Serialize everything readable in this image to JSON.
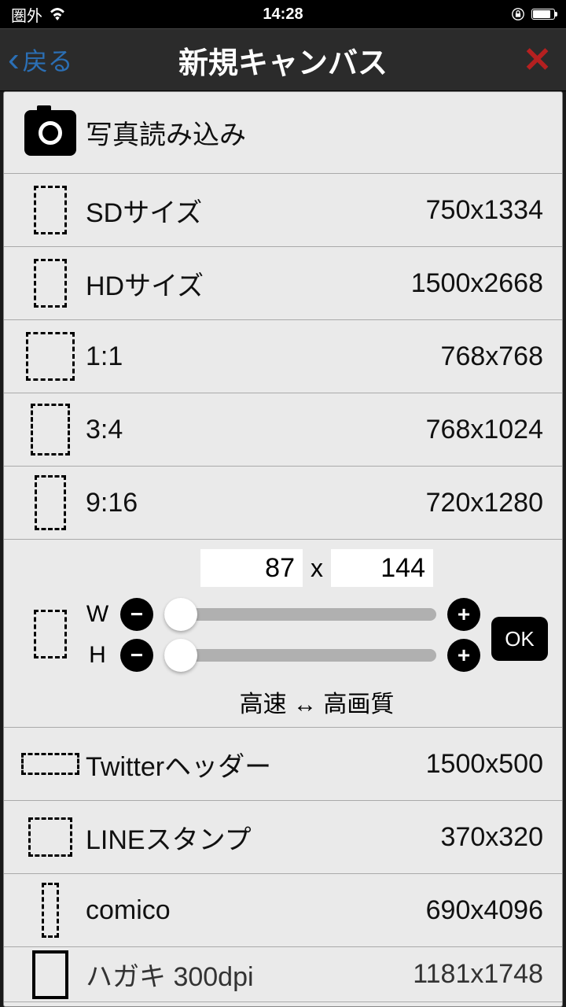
{
  "status": {
    "carrier": "圏外",
    "time": "14:28"
  },
  "nav": {
    "back": "戻る",
    "title": "新規キャンバス"
  },
  "photo_import": "写真読み込み",
  "presets": [
    {
      "label": "SDサイズ",
      "size": "750x1334",
      "shape": "dash-port"
    },
    {
      "label": "HDサイズ",
      "size": "1500x2668",
      "shape": "dash-port"
    },
    {
      "label": "1:1",
      "size": "768x768",
      "shape": "dash-sq"
    },
    {
      "label": "3:4",
      "size": "768x1024",
      "shape": "dash-34"
    },
    {
      "label": "9:16",
      "size": "720x1280",
      "shape": "dash-916"
    }
  ],
  "custom": {
    "w_value": "87",
    "h_value": "144",
    "x": "x",
    "w_label": "W",
    "h_label": "H",
    "minus": "−",
    "plus": "+",
    "ok": "OK",
    "quality": "高速 ↔ 高画質"
  },
  "presets2": [
    {
      "label": "Twitterヘッダー",
      "size": "1500x500",
      "shape": "dash-wide"
    },
    {
      "label": "LINEスタンプ",
      "size": "370x320",
      "shape": "dash-small"
    },
    {
      "label": "comico",
      "size": "690x4096",
      "shape": "dash-tall"
    },
    {
      "label": "ハガキ 300dpi",
      "size": "1181x1748",
      "shape": "solid-port"
    }
  ]
}
